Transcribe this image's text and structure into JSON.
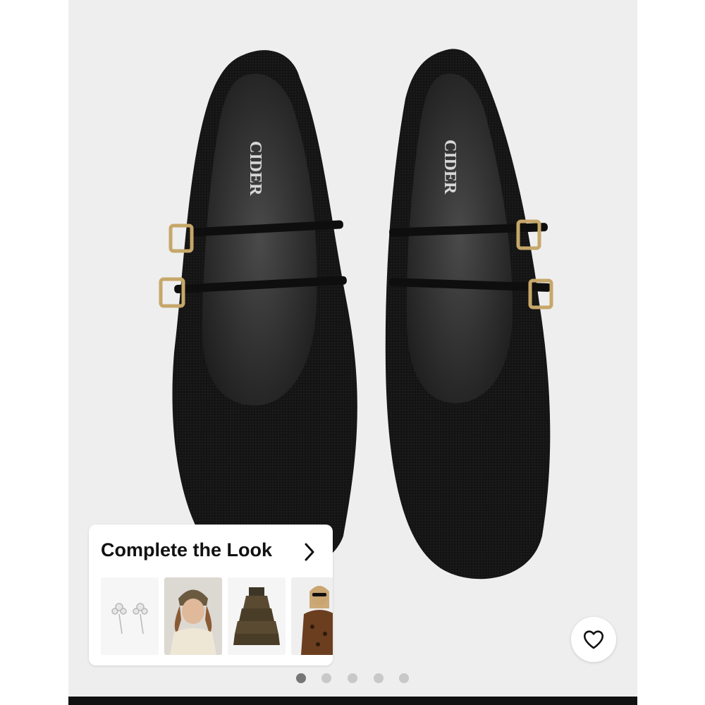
{
  "product_image": {
    "alt": "product-photo",
    "brand_insole_text": "CIDER"
  },
  "complete_the_look": {
    "title": "Complete the Look",
    "chevron_icon": "chevron-right-icon",
    "items": [
      {
        "name": "earrings"
      },
      {
        "name": "bandana-model"
      },
      {
        "name": "ruffle-dress"
      },
      {
        "name": "leopard-top-model"
      }
    ]
  },
  "favorite": {
    "icon": "heart-outline-icon"
  },
  "carousel": {
    "count": 5,
    "active_index": 0
  },
  "colors": {
    "gallery_bg": "#eeeeee",
    "bottom_bar": "#111111",
    "dot_active": "#757575",
    "dot_inactive": "#c8c8c8"
  }
}
